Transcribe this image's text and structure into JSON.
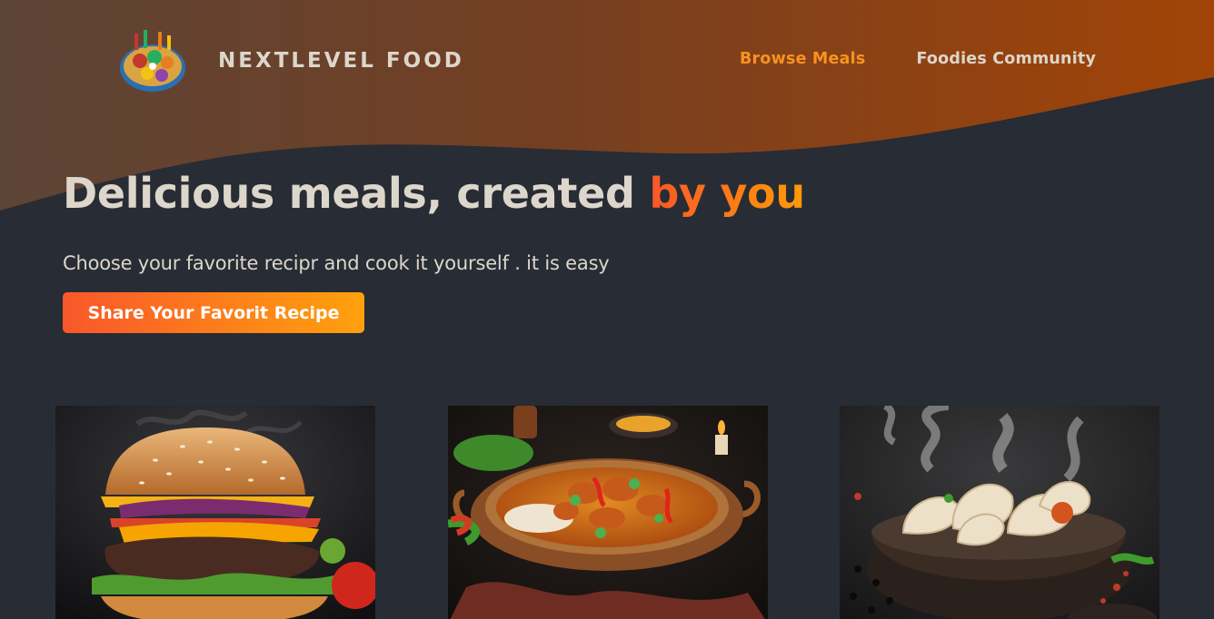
{
  "header": {
    "logo_text": "NextLevel Food",
    "logo_icon": "food-platter-icon",
    "nav": [
      {
        "label": "Browse Meals",
        "active": true
      },
      {
        "label": "Foodies Community",
        "active": false
      }
    ]
  },
  "hero": {
    "title_main": "Delicious meals, created ",
    "title_highlight": "by you",
    "subtitle": "Choose your favorite recipr and cook it yourself . it is easy",
    "cta_label": "Share Your Favorit Recipe"
  },
  "gallery": {
    "items": [
      {
        "image": "burger-photo"
      },
      {
        "image": "curry-photo"
      },
      {
        "image": "dumplings-photo"
      }
    ]
  },
  "colors": {
    "background": "#282c34",
    "accent": "#f9572a",
    "accent_secondary": "#ff9b05",
    "nav_active": "#f7931e",
    "text": "#ddd6cb"
  }
}
